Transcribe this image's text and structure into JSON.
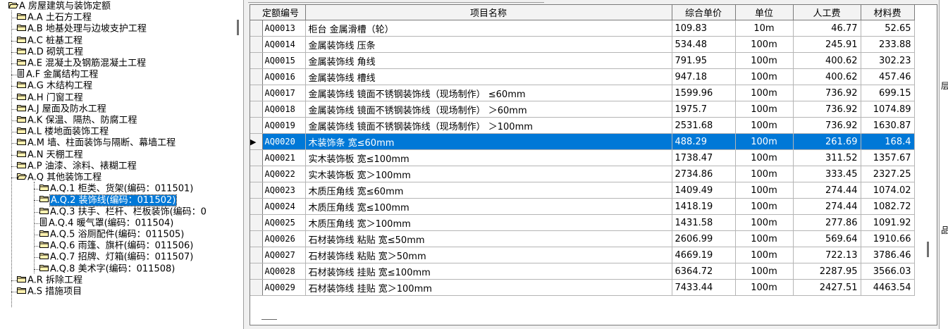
{
  "tree": {
    "nodes": [
      {
        "label": "A 房屋建筑与装饰定额",
        "level": 0,
        "icon": "folder-open"
      },
      {
        "label": "A.A 土石方工程",
        "level": 1,
        "icon": "folder"
      },
      {
        "label": "A.B 地基处理与边坡支护工程",
        "level": 1,
        "icon": "folder"
      },
      {
        "label": "A.C 桩基工程",
        "level": 1,
        "icon": "folder"
      },
      {
        "label": "A.D 砌筑工程",
        "level": 1,
        "icon": "folder"
      },
      {
        "label": "A.E 混凝土及钢筋混凝土工程",
        "level": 1,
        "icon": "folder"
      },
      {
        "label": "A.F 金属结构工程",
        "level": 1,
        "icon": "document"
      },
      {
        "label": "A.G 木结构工程",
        "level": 1,
        "icon": "folder"
      },
      {
        "label": "A.H 门窗工程",
        "level": 1,
        "icon": "folder"
      },
      {
        "label": "A.J 屋面及防水工程",
        "level": 1,
        "icon": "folder"
      },
      {
        "label": "A.K 保温、隔热、防腐工程",
        "level": 1,
        "icon": "folder"
      },
      {
        "label": "A.L 楼地面装饰工程",
        "level": 1,
        "icon": "folder"
      },
      {
        "label": "A.M 墙、柱面装饰与隔断、幕墙工程",
        "level": 1,
        "icon": "folder"
      },
      {
        "label": "A.N 天棚工程",
        "level": 1,
        "icon": "folder"
      },
      {
        "label": "A.P 油漆、涂料、裱糊工程",
        "level": 1,
        "icon": "folder"
      },
      {
        "label": "A.Q 其他装饰工程",
        "level": 1,
        "icon": "folder-open"
      },
      {
        "label": "A.Q.1 柜类、货架(编码：011501)",
        "level": 2,
        "icon": "folder"
      },
      {
        "label": "A.Q.2 装饰线(编码：011502)",
        "level": 2,
        "icon": "folder",
        "selected": true
      },
      {
        "label": "A.Q.3 扶手、栏杆、栏板装饰(编码：0",
        "level": 2,
        "icon": "folder"
      },
      {
        "label": "A.Q.4 暖气罩(编码：011504)",
        "level": 2,
        "icon": "document"
      },
      {
        "label": "A.Q.5 浴厕配件(编码：011505)",
        "level": 2,
        "icon": "folder"
      },
      {
        "label": "A.Q.6 雨篷、旗杆(编码：011506)",
        "level": 2,
        "icon": "folder"
      },
      {
        "label": "A.Q.7 招牌、灯箱(编码：011507)",
        "level": 2,
        "icon": "folder"
      },
      {
        "label": "A.Q.8 美术字(编码：011508)",
        "level": 2,
        "icon": "folder"
      },
      {
        "label": "A.R 拆除工程",
        "level": 1,
        "icon": "folder"
      },
      {
        "label": "A.S 措施项目",
        "level": 1,
        "icon": "folder"
      }
    ]
  },
  "grid": {
    "columns": [
      "定额编号",
      "项目名称",
      "综合单价",
      "单位",
      "人工费",
      "材料费"
    ],
    "selected_marker": "▶",
    "rows": [
      {
        "code": "AQ0013",
        "name": "柜台 金属滑槽（轮）",
        "price": "109.83",
        "unit": "10m",
        "labor": "46.77",
        "material": "52.65"
      },
      {
        "code": "AQ0014",
        "name": "金属装饰线 压条",
        "price": "534.48",
        "unit": "100m",
        "labor": "245.91",
        "material": "233.88"
      },
      {
        "code": "AQ0015",
        "name": "金属装饰线 角线",
        "price": "791.95",
        "unit": "100m",
        "labor": "400.62",
        "material": "302.23"
      },
      {
        "code": "AQ0016",
        "name": "金属装饰线 槽线",
        "price": "947.18",
        "unit": "100m",
        "labor": "400.62",
        "material": "457.46"
      },
      {
        "code": "AQ0017",
        "name": "金属装饰线 镜面不锈钢装饰线（现场制作） ≤60mm",
        "price": "1599.96",
        "unit": "100m",
        "labor": "736.92",
        "material": "699.15"
      },
      {
        "code": "AQ0018",
        "name": "金属装饰线 镜面不锈钢装饰线（现场制作） ＞60mm",
        "price": "1975.7",
        "unit": "100m",
        "labor": "736.92",
        "material": "1074.89"
      },
      {
        "code": "AQ0019",
        "name": "金属装饰线 镜面不锈钢装饰线（现场制作） ＞100mm",
        "price": "2531.68",
        "unit": "100m",
        "labor": "736.92",
        "material": "1630.87"
      },
      {
        "code": "AQ0020",
        "name": "木装饰条 宽≤60mm",
        "price": "488.29",
        "unit": "100m",
        "labor": "261.69",
        "material": "168.4",
        "selected": true
      },
      {
        "code": "AQ0021",
        "name": "实木装饰板 宽≤100mm",
        "price": "1738.47",
        "unit": "100m",
        "labor": "311.52",
        "material": "1357.67"
      },
      {
        "code": "AQ0022",
        "name": "实木装饰板 宽＞100mm",
        "price": "2734.86",
        "unit": "100m",
        "labor": "333.45",
        "material": "2327.25"
      },
      {
        "code": "AQ0023",
        "name": "木质压角线 宽≤60mm",
        "price": "1409.49",
        "unit": "100m",
        "labor": "274.44",
        "material": "1074.02"
      },
      {
        "code": "AQ0024",
        "name": "木质压角线 宽≤100mm",
        "price": "1418.19",
        "unit": "100m",
        "labor": "274.44",
        "material": "1082.72"
      },
      {
        "code": "AQ0025",
        "name": "木质压角线 宽＞100mm",
        "price": "1431.58",
        "unit": "100m",
        "labor": "277.86",
        "material": "1091.92"
      },
      {
        "code": "AQ0026",
        "name": "石材装饰线 粘贴 宽≤50mm",
        "price": "2606.99",
        "unit": "100m",
        "labor": "569.64",
        "material": "1910.66"
      },
      {
        "code": "AQ0027",
        "name": "石材装饰线 粘贴 宽＞50mm",
        "price": "4669.19",
        "unit": "100m",
        "labor": "722.13",
        "material": "3786.46"
      },
      {
        "code": "AQ0028",
        "name": "石材装饰线 挂贴 宽≤100mm",
        "price": "6364.72",
        "unit": "100m",
        "labor": "2287.95",
        "material": "3566.03"
      },
      {
        "code": "AQ0029",
        "name": "石材装饰线 挂贴 宽＞100mm",
        "price": "7433.44",
        "unit": "100m",
        "labor": "2427.51",
        "material": "4463.54"
      }
    ]
  },
  "right_strip": {
    "chars": [
      "层",
      "品"
    ]
  },
  "colors": {
    "selection": "#0078d7",
    "header_bg": "#f3f3f3",
    "folder_yellow": "#fff2b0"
  }
}
